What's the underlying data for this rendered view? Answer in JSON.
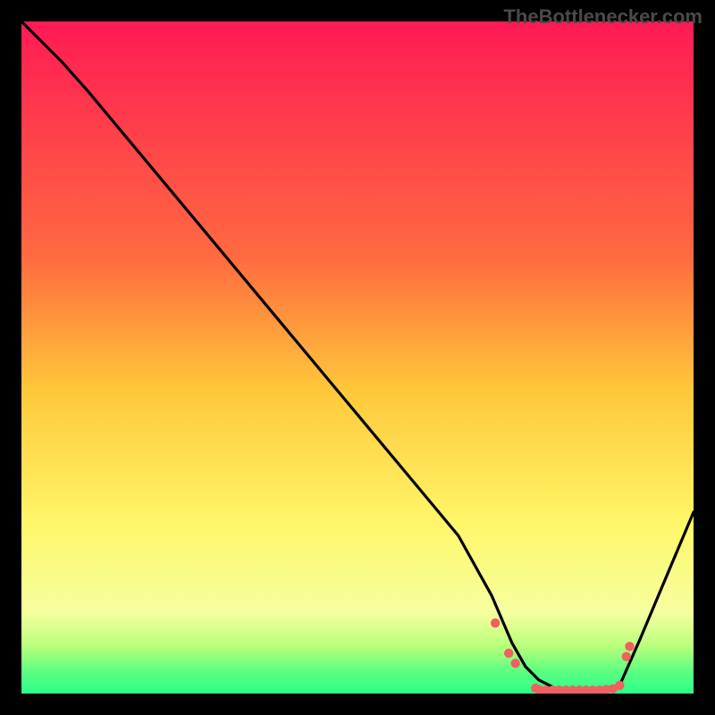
{
  "watermark": "TheBottlenecker.com",
  "colors": {
    "bg_black": "#000000",
    "grad_top": "#ff1a55",
    "grad_mid1": "#ff6a40",
    "grad_mid2": "#ffc83a",
    "grad_mid3": "#fff76a",
    "grad_low": "#f6ffa0",
    "grad_bottom1": "#b8ff7a",
    "grad_bottom2": "#2aff8a",
    "line": "#000000",
    "dot": "#f06060"
  },
  "chart_data": {
    "type": "line",
    "x": [
      0.0,
      0.06,
      0.1,
      0.2,
      0.3,
      0.4,
      0.5,
      0.6,
      0.65,
      0.7,
      0.73,
      0.75,
      0.77,
      0.79,
      0.8,
      0.82,
      0.84,
      0.86,
      0.88,
      0.89,
      0.92,
      1.0
    ],
    "values": [
      1.0,
      0.94,
      0.895,
      0.775,
      0.655,
      0.535,
      0.415,
      0.295,
      0.235,
      0.145,
      0.075,
      0.04,
      0.02,
      0.01,
      0.005,
      0.005,
      0.005,
      0.005,
      0.008,
      0.012,
      0.08,
      0.27
    ],
    "dots_x": [
      0.705,
      0.725,
      0.735,
      0.765,
      0.77,
      0.78,
      0.79,
      0.8,
      0.81,
      0.82,
      0.83,
      0.84,
      0.85,
      0.86,
      0.87,
      0.88,
      0.89,
      0.9,
      0.905
    ],
    "dots_y": [
      0.105,
      0.06,
      0.045,
      0.008,
      0.006,
      0.005,
      0.005,
      0.005,
      0.005,
      0.005,
      0.005,
      0.005,
      0.005,
      0.005,
      0.006,
      0.007,
      0.012,
      0.055,
      0.07
    ],
    "title": "",
    "xlabel": "",
    "ylabel": "",
    "xlim": [
      0,
      1
    ],
    "ylim": [
      0,
      1
    ]
  }
}
